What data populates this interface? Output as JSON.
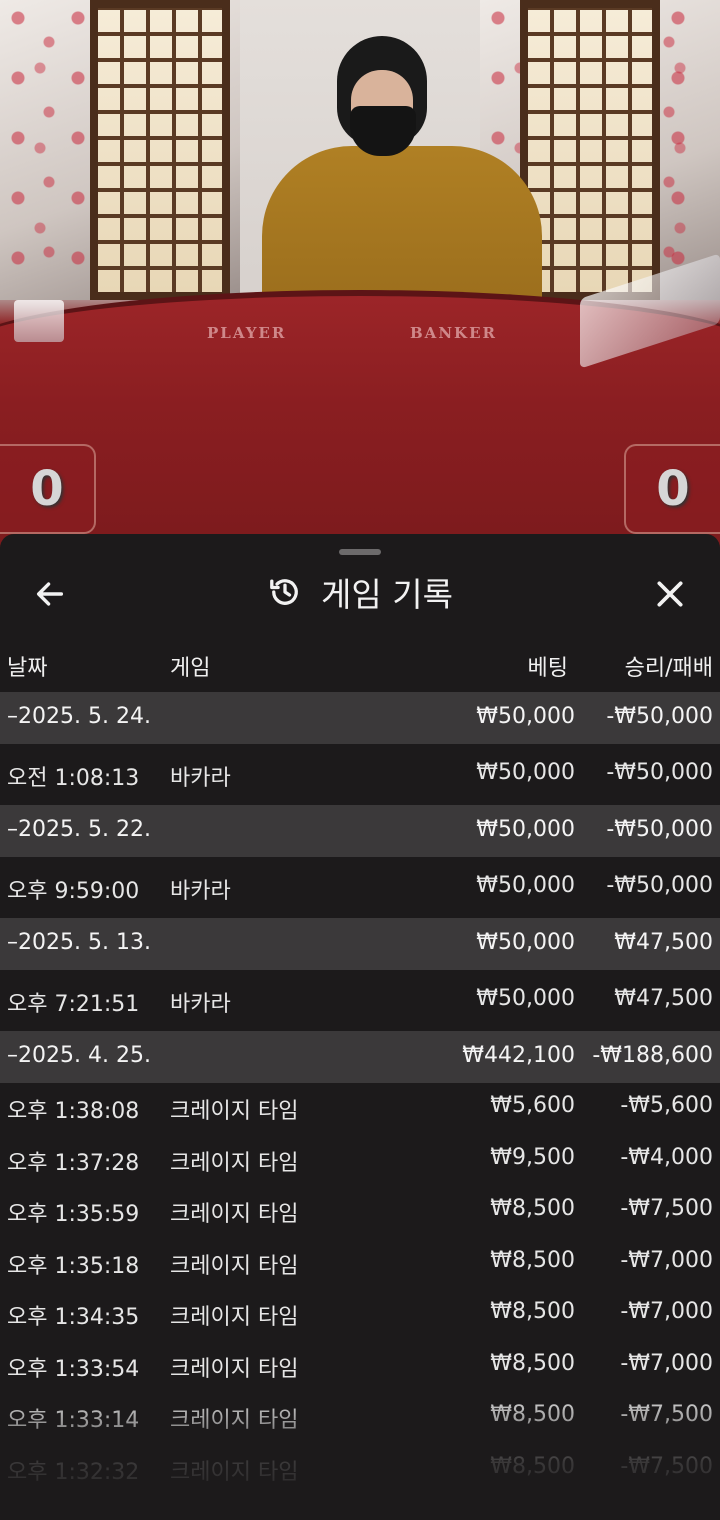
{
  "video": {
    "table_labels": {
      "player": "PLAYER",
      "banker": "BANKER"
    },
    "score_left": "0",
    "score_right": "0"
  },
  "panel": {
    "title": "게임 기록",
    "back_icon": "arrow-left-icon",
    "title_icon": "history-icon",
    "close_icon": "close-icon",
    "columns": {
      "date": "날짜",
      "game": "게임",
      "bet": "베팅",
      "result": "승리/패배"
    }
  },
  "rows": [
    {
      "type": "date",
      "date": "–2025. 5. 24.",
      "game": "",
      "bet": "₩50,000",
      "result": "-₩50,000"
    },
    {
      "type": "entry-tall",
      "date": "오전 1:08:13",
      "game": "바카라",
      "bet": "₩50,000",
      "result": "-₩50,000"
    },
    {
      "type": "date",
      "date": "–2025. 5. 22.",
      "game": "",
      "bet": "₩50,000",
      "result": "-₩50,000"
    },
    {
      "type": "entry-tall",
      "date": "오후 9:59:00",
      "game": "바카라",
      "bet": "₩50,000",
      "result": "-₩50,000"
    },
    {
      "type": "date",
      "date": "–2025. 5. 13.",
      "game": "",
      "bet": "₩50,000",
      "result": "₩47,500"
    },
    {
      "type": "entry-tall",
      "date": "오후 7:21:51",
      "game": "바카라",
      "bet": "₩50,000",
      "result": "₩47,500"
    },
    {
      "type": "date",
      "date": "–2025. 4. 25.",
      "game": "",
      "bet": "₩442,100",
      "result": "-₩188,600"
    },
    {
      "type": "entry",
      "date": "오후 1:38:08",
      "game": "크레이지 타임",
      "bet": "₩5,600",
      "result": "-₩5,600"
    },
    {
      "type": "entry",
      "date": "오후 1:37:28",
      "game": "크레이지 타임",
      "bet": "₩9,500",
      "result": "-₩4,000"
    },
    {
      "type": "entry",
      "date": "오후 1:35:59",
      "game": "크레이지 타임",
      "bet": "₩8,500",
      "result": "-₩7,500"
    },
    {
      "type": "entry",
      "date": "오후 1:35:18",
      "game": "크레이지 타임",
      "bet": "₩8,500",
      "result": "-₩7,000"
    },
    {
      "type": "entry",
      "date": "오후 1:34:35",
      "game": "크레이지 타임",
      "bet": "₩8,500",
      "result": "-₩7,000"
    },
    {
      "type": "entry",
      "date": "오후 1:33:54",
      "game": "크레이지 타임",
      "bet": "₩8,500",
      "result": "-₩7,000"
    },
    {
      "type": "entry",
      "date": "오후 1:33:14",
      "game": "크레이지 타임",
      "bet": "₩8,500",
      "result": "-₩7,500"
    },
    {
      "type": "entry",
      "date": "오후 1:32:32",
      "game": "크레이지 타임",
      "bet": "₩8,500",
      "result": "-₩7,500"
    }
  ]
}
